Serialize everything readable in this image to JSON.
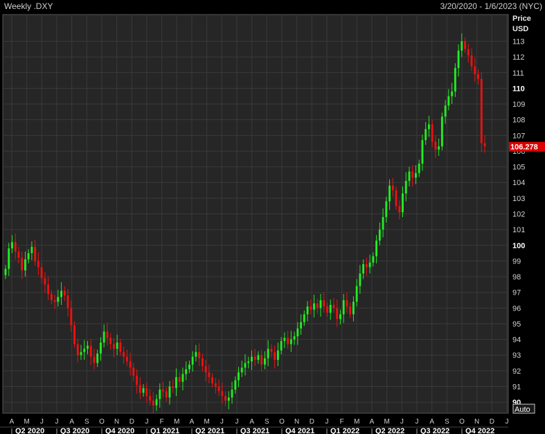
{
  "header": {
    "title": "Weekly .DXY",
    "date_range": "3/20/2020 - 1/6/2023 (NYC)"
  },
  "y_axis": {
    "label_line1": "Price",
    "label_line2": "USD",
    "auto_button": "Auto"
  },
  "colors": {
    "background": "#000000",
    "plot_background": "#262626",
    "grid": "#3a3a3a",
    "up": "#22ee22",
    "down": "#ee1111",
    "last_price_box": "#dd0000"
  },
  "chart_data": {
    "type": "candlestick",
    "title": "Weekly .DXY",
    "ylabel": "Price USD",
    "ylim": [
      89.3,
      114.7
    ],
    "y_ticks": [
      90,
      91,
      92,
      93,
      94,
      95,
      96,
      97,
      98,
      99,
      100,
      101,
      102,
      103,
      104,
      105,
      106,
      107,
      108,
      109,
      110,
      111,
      112,
      113
    ],
    "y_ticks_bold": [
      90,
      100,
      110
    ],
    "last_price": "106.278",
    "month_labels": [
      "A",
      "M",
      "J",
      "J",
      "A",
      "S",
      "O",
      "N",
      "D",
      "J",
      "F",
      "M",
      "A",
      "M",
      "J",
      "J",
      "A",
      "S",
      "O",
      "N",
      "D",
      "J",
      "F",
      "M",
      "A",
      "M",
      "J",
      "J",
      "A",
      "S",
      "O",
      "N",
      "D",
      "J"
    ],
    "quarter_labels": [
      "Q2 2020",
      "Q3 2020",
      "Q4 2020",
      "Q1 2021",
      "Q2 2021",
      "Q3 2021",
      "Q4 2021",
      "Q1 2022",
      "Q2 2022",
      "Q3 2022",
      "Q4 2022"
    ],
    "close": [
      98.5,
      99.8,
      100.2,
      99.6,
      99.2,
      98.4,
      99.1,
      99.5,
      99.9,
      99.0,
      98.6,
      97.9,
      97.5,
      96.9,
      96.5,
      96.4,
      96.7,
      97.1,
      96.8,
      96.0,
      94.9,
      93.7,
      93.0,
      93.2,
      93.4,
      93.6,
      92.9,
      92.5,
      93.1,
      93.8,
      94.5,
      94.1,
      93.7,
      93.4,
      93.8,
      93.2,
      92.9,
      92.6,
      92.2,
      91.7,
      91.1,
      90.6,
      90.9,
      90.4,
      90.1,
      89.8,
      90.2,
      90.8,
      90.7,
      90.3,
      91.0,
      90.9,
      91.6,
      91.3,
      91.8,
      92.1,
      92.4,
      92.9,
      93.2,
      92.8,
      92.3,
      91.9,
      91.6,
      91.2,
      91.0,
      90.7,
      90.4,
      90.1,
      90.3,
      90.8,
      91.4,
      91.9,
      92.2,
      92.5,
      92.6,
      92.9,
      92.7,
      93.0,
      92.4,
      92.8,
      93.4,
      93.2,
      92.7,
      93.3,
      93.9,
      94.1,
      93.7,
      94.0,
      94.2,
      94.7,
      95.1,
      95.6,
      96.1,
      95.9,
      96.3,
      96.0,
      96.5,
      96.1,
      95.7,
      96.2,
      96.0,
      95.3,
      95.6,
      96.5,
      96.1,
      95.6,
      96.4,
      97.4,
      98.2,
      98.8,
      98.6,
      98.9,
      99.3,
      100.3,
      101.0,
      101.8,
      102.8,
      103.8,
      103.5,
      102.5,
      102.1,
      103.3,
      104.1,
      104.7,
      104.3,
      104.6,
      105.2,
      106.7,
      107.4,
      107.7,
      106.6,
      106.1,
      106.3,
      108.2,
      108.9,
      109.5,
      109.8,
      111.3,
      112.4,
      113.0,
      112.5,
      112.1,
      111.4,
      110.9,
      110.6,
      106.5,
      106.3
    ],
    "series": [
      {
        "name": "",
        "values": []
      }
    ]
  }
}
